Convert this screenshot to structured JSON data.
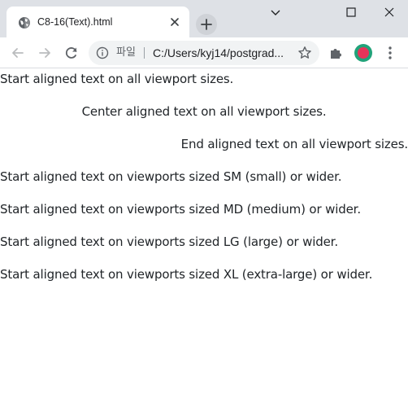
{
  "browser": {
    "tab": {
      "title": "C8-16(Text).html"
    },
    "address_bar": {
      "chip_label": "파일",
      "url": "C:/Users/kyj14/postgrad..."
    },
    "colors": {
      "tabstrip": "#dee1e6",
      "toolbar": "#ffffff",
      "omnibox": "#f1f3f4",
      "profile_ring": "#21a37a",
      "profile_fill": "#e8345a"
    },
    "icons": {
      "favicon": "globe-icon",
      "tab_close": "close-icon",
      "new_tab": "plus-icon",
      "minimize": "minimize-icon",
      "maximize": "maximize-icon",
      "window_close": "close-icon",
      "back": "arrow-left-icon",
      "forward": "arrow-right-icon",
      "reload": "reload-icon",
      "site_info": "info-icon",
      "bookmark": "star-icon",
      "extensions": "puzzle-icon",
      "profile": "avatar-icon",
      "menu": "kebab-menu-icon"
    }
  },
  "page": {
    "lines": [
      {
        "text": "Start aligned text on all viewport sizes.",
        "align": "start"
      },
      {
        "text": "Center aligned text on all viewport sizes.",
        "align": "center"
      },
      {
        "text": "End aligned text on all viewport sizes.",
        "align": "end"
      },
      {
        "text": "Start aligned text on viewports sized SM (small) or wider.",
        "align": "start"
      },
      {
        "text": "Start aligned text on viewports sized MD (medium) or wider.",
        "align": "start"
      },
      {
        "text": "Start aligned text on viewports sized LG (large) or wider.",
        "align": "start"
      },
      {
        "text": "Start aligned text on viewports sized XL (extra-large) or wider.",
        "align": "start"
      }
    ]
  }
}
